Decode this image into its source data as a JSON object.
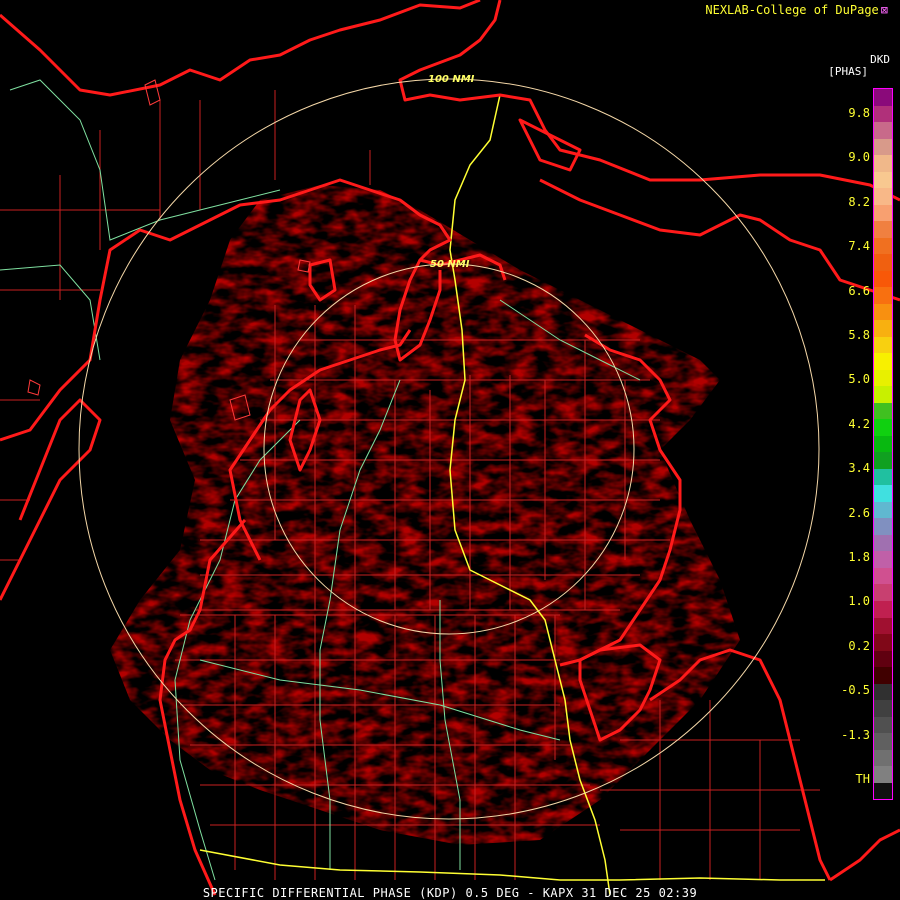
{
  "header": {
    "credit": "NEXLAB-College of DuPage",
    "logo_icon": "cod-logo-icon"
  },
  "legend": {
    "unit_top": "DKD",
    "unit_bottom": "[PHAS]",
    "labels": [
      "9.8",
      "9.0",
      "8.2",
      "7.4",
      "6.6",
      "5.8",
      "5.0",
      "4.2",
      "3.4",
      "2.6",
      "1.8",
      "1.0",
      "0.2",
      "-0.5",
      "-1.3",
      "TH"
    ],
    "colors": [
      "#8a0a7a",
      "#b0307a",
      "#c86a8a",
      "#d89a8a",
      "#f0b88a",
      "#f8c890",
      "#f8b888",
      "#f8a070",
      "#f08040",
      "#f07020",
      "#f06010",
      "#f85808",
      "#f87010",
      "#f89010",
      "#f8b010",
      "#f8d010",
      "#f8f000",
      "#e8f000",
      "#c8f000",
      "#40c020",
      "#10d010",
      "#08b810",
      "#10a020",
      "#20c0a0",
      "#40e0e0",
      "#60b8d0",
      "#8090c0",
      "#a070b0",
      "#c060a8",
      "#d05090",
      "#c84070",
      "#c02050",
      "#a01030",
      "#800818",
      "#600010",
      "#400000",
      "#303030",
      "#404040",
      "#505050",
      "#606060",
      "#707070",
      "#808080",
      "#101010"
    ]
  },
  "map": {
    "range_rings": [
      {
        "label": "100 NMI"
      },
      {
        "label": "50 NMI"
      }
    ],
    "radar_site": "KAPX"
  },
  "footer": {
    "caption": "SPECIFIC DIFFERENTIAL PHASE (KDP) 0.5 DEG - KAPX 31 DEC 25 02:39"
  }
}
